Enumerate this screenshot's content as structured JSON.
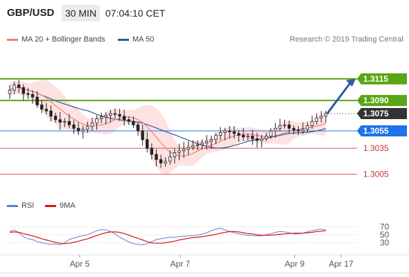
{
  "header": {
    "pair": "GBP/USD",
    "timeframe": "30 MIN",
    "time": "07:04:10 CET"
  },
  "legend": {
    "ma20_label": "MA 20 + Bollinger Bands",
    "ma50_label": "MA 50",
    "watermark": "Research © 2019 Trading Central"
  },
  "rsi_legend": {
    "rsi_label": "RSI",
    "ma_label": "9MA"
  },
  "colors": {
    "candle": "#222222",
    "bollinger_fill": "#fde2e2",
    "ma20": "#f08080",
    "ma50": "#2c5aa0",
    "resistance": "#5aa514",
    "current": "#333333",
    "pivot": "#1e73e8",
    "support": "#e05050",
    "arrow": "#2c5aa0",
    "rsi": "#5b7fd6",
    "rsi_ma": "#e01010"
  },
  "chart_data": [
    {
      "type": "candlestick",
      "title": "GBP/USD",
      "timeframe": "30 MIN",
      "ylim": [
        1.298,
        1.315
      ],
      "x_ticks": [
        "Apr 5",
        "Apr 7",
        "Apr 9",
        "Apr 17"
      ],
      "closes": [
        1.3102,
        1.3108,
        1.3105,
        1.3098,
        1.3097,
        1.3094,
        1.3085,
        1.308,
        1.3078,
        1.3072,
        1.3068,
        1.3065,
        1.3066,
        1.3062,
        1.3058,
        1.3055,
        1.3057,
        1.306,
        1.3064,
        1.3069,
        1.3071,
        1.3073,
        1.3075,
        1.3074,
        1.3072,
        1.3068,
        1.3066,
        1.3062,
        1.3055,
        1.3045,
        1.3035,
        1.3028,
        1.3022,
        1.3018,
        1.302,
        1.3025,
        1.303,
        1.3032,
        1.3034,
        1.3036,
        1.3038,
        1.3039,
        1.3041,
        1.3043,
        1.3045,
        1.305,
        1.3053,
        1.3055,
        1.3054,
        1.3052,
        1.305,
        1.3048,
        1.3049,
        1.3046,
        1.3044,
        1.3046,
        1.3049,
        1.3055,
        1.3058,
        1.3061,
        1.3062,
        1.3058,
        1.3056,
        1.3055,
        1.3057,
        1.3061,
        1.3066,
        1.307,
        1.3072,
        1.3075
      ],
      "levels": [
        {
          "label": "1.3115",
          "value": 1.3115,
          "kind": "resistance"
        },
        {
          "label": "1.3090",
          "value": 1.309,
          "kind": "resistance"
        },
        {
          "label": "1.3075",
          "value": 1.3075,
          "kind": "current"
        },
        {
          "label": "1.3055",
          "value": 1.3055,
          "kind": "pivot"
        },
        {
          "label": "1.3035",
          "value": 1.3035,
          "kind": "support"
        },
        {
          "label": "1.3005",
          "value": 1.3005,
          "kind": "support"
        }
      ],
      "series": [
        {
          "name": "MA 20 + Bollinger Bands"
        },
        {
          "name": "MA 50"
        }
      ]
    },
    {
      "type": "line",
      "ylim": [
        0,
        100
      ],
      "y_ticks": [
        30,
        50,
        70
      ],
      "series": [
        {
          "name": "RSI",
          "values": [
            58,
            62,
            55,
            45,
            40,
            38,
            33,
            30,
            28,
            26,
            27,
            25,
            30,
            38,
            42,
            45,
            48,
            50,
            55,
            60,
            63,
            62,
            58,
            52,
            44,
            38,
            32,
            28,
            26,
            25,
            28,
            33,
            38,
            40,
            42,
            44,
            44,
            45,
            46,
            47,
            48,
            49,
            52,
            55,
            60,
            64,
            66,
            62,
            58,
            55,
            52,
            50,
            49,
            48,
            47,
            48,
            50,
            53,
            56,
            58,
            57,
            55,
            52,
            52,
            54,
            57,
            60,
            63,
            64,
            62
          ]
        },
        {
          "name": "9MA",
          "values": [
            56,
            57,
            56,
            53,
            50,
            47,
            44,
            40,
            37,
            34,
            31,
            29,
            28,
            29,
            31,
            34,
            37,
            40,
            44,
            48,
            52,
            55,
            57,
            57,
            56,
            53,
            49,
            45,
            41,
            37,
            33,
            30,
            29,
            29,
            30,
            32,
            34,
            37,
            39,
            41,
            43,
            44,
            45,
            47,
            49,
            51,
            54,
            56,
            58,
            58,
            57,
            55,
            53,
            52,
            50,
            49,
            49,
            49,
            50,
            51,
            52,
            53,
            54,
            54,
            54,
            55,
            56,
            58,
            59,
            60
          ]
        }
      ]
    }
  ]
}
